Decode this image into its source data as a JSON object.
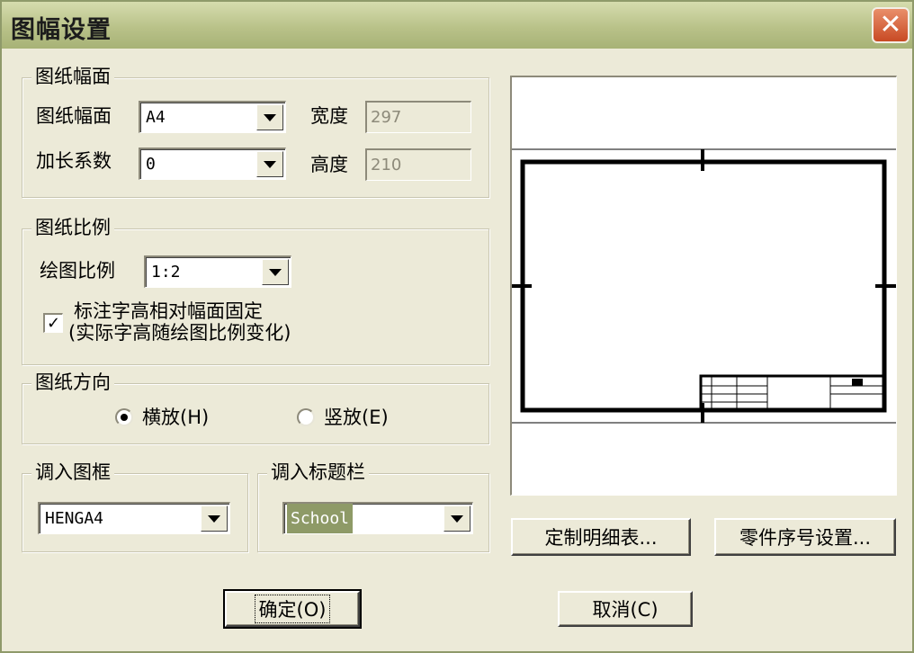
{
  "window": {
    "title": "图幅设置"
  },
  "paper_size": {
    "legend": "图纸幅面",
    "size_label": "图纸幅面",
    "size_value": "A4",
    "extend_label": "加长系数",
    "extend_value": "0",
    "width_label": "宽度",
    "width_value": "297",
    "height_label": "高度",
    "height_value": "210"
  },
  "scale": {
    "legend": "图纸比例",
    "drawing_scale_label": "绘图比例",
    "drawing_scale_value": "1:2",
    "fixed_text_label_line1": "标注字高相对幅面固定",
    "fixed_text_label_line2": "(实际字高随绘图比例变化)",
    "fixed_text_checked": true
  },
  "orientation": {
    "legend": "图纸方向",
    "landscape_label": "横放(H)",
    "portrait_label": "竖放(E)",
    "selected": "landscape"
  },
  "frame": {
    "legend": "调入图框",
    "value": "HENGA4"
  },
  "title_block": {
    "legend": "调入标题栏",
    "value": "School"
  },
  "buttons": {
    "custom_bom": "定制明细表...",
    "part_number": "零件序号设置...",
    "ok": "确定(O)",
    "cancel": "取消(C)"
  },
  "icons": {
    "close": "close-icon",
    "dropdown": "chevron-down-icon",
    "check": "check-icon"
  },
  "colors": {
    "titlebar": "#b9c289",
    "close": "#c84a24",
    "selection": "#8e9a67",
    "face": "#ecead8"
  }
}
